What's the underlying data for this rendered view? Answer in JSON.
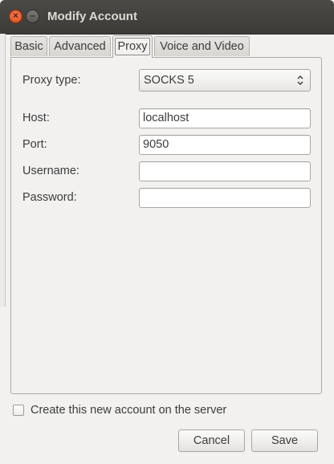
{
  "window": {
    "title": "Modify Account"
  },
  "tabs": [
    {
      "label": "Basic",
      "active": false
    },
    {
      "label": "Advanced",
      "active": false
    },
    {
      "label": "Proxy",
      "active": true
    },
    {
      "label": "Voice and Video",
      "active": false
    }
  ],
  "proxy": {
    "type_label": "Proxy type:",
    "type_value": "SOCKS 5",
    "host_label": "Host:",
    "host_value": "localhost",
    "port_label": "Port:",
    "port_value": "9050",
    "username_label": "Username:",
    "username_value": "",
    "password_label": "Password:",
    "password_value": ""
  },
  "create_account": {
    "label": "Create this new account on the server",
    "checked": false
  },
  "buttons": {
    "cancel": "Cancel",
    "save": "Save"
  },
  "colors": {
    "close_button": "#df4a16",
    "titlebar": "#3c3b37",
    "window_bg": "#f2f1f0"
  }
}
